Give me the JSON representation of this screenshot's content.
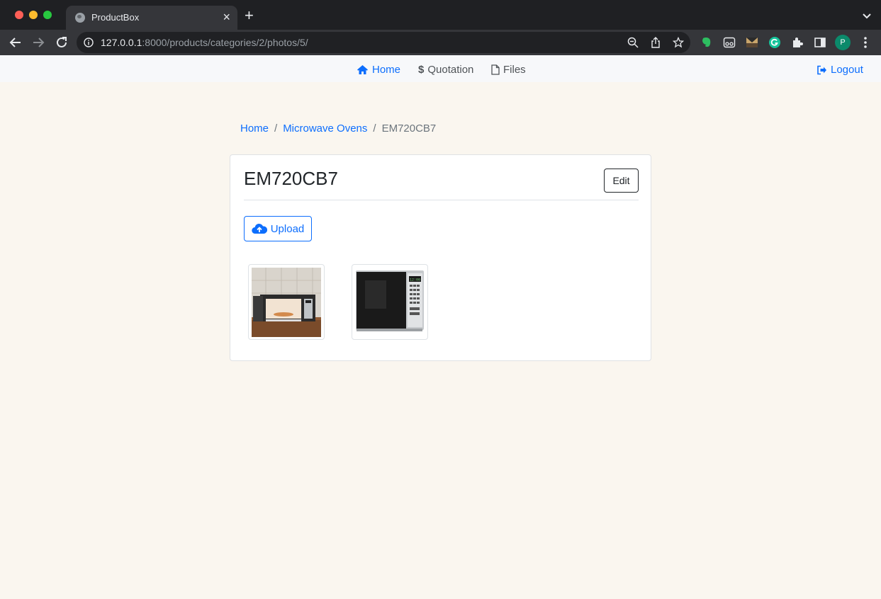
{
  "browser": {
    "tab_title": "ProductBox",
    "url_host": "127.0.0.1",
    "url_rest": ":8000/products/categories/2/photos/5/",
    "profile_initial": "P"
  },
  "navbar": {
    "home": "Home",
    "quotation": "Quotation",
    "files": "Files",
    "logout": "Logout"
  },
  "breadcrumb": {
    "home": "Home",
    "category": "Microwave Ovens",
    "current": "EM720CB7"
  },
  "product": {
    "title": "EM720CB7",
    "edit_label": "Edit",
    "upload_label": "Upload"
  },
  "colors": {
    "page_bg": "#faf6ef",
    "accent": "#0d6efd",
    "chrome_dark": "#1f2023"
  },
  "icons": {
    "home": "home-icon",
    "quotation": "dollar-icon",
    "files": "file-icon",
    "logout": "sign-out-icon",
    "upload": "cloud-upload-icon"
  }
}
